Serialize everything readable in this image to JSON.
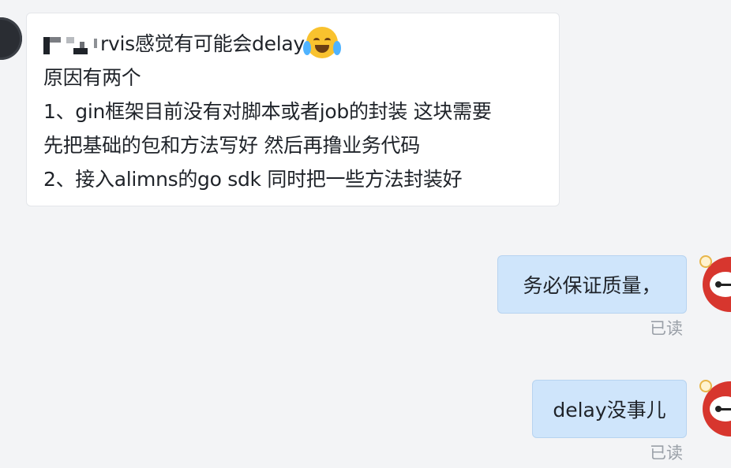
{
  "chat": {
    "incoming": {
      "name_visible": "rvis",
      "lines": [
        "感觉有可能会delay",
        "原因有两个",
        "1、gin框架目前没有对脚本或者job的封装 这块需要",
        "先把基础的包和方法写好 然后再撸业务代码",
        "2、接入alimns的go sdk 同时把一些方法封装好"
      ],
      "emoji": "crying-laughing-emoji"
    },
    "outgoing": [
      {
        "text": "务必保证质量，",
        "status": "已读"
      },
      {
        "text": "delay没事儿",
        "status": "已读"
      }
    ]
  },
  "colors": {
    "background": "#f3f4f6",
    "incoming_bubble": "#ffffff",
    "outgoing_bubble": "#cfe5fb",
    "read_status": "#9aa0a8"
  }
}
